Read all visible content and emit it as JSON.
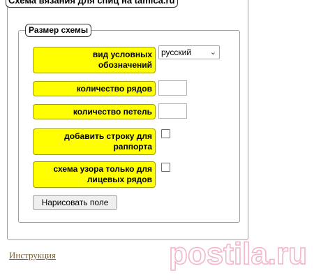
{
  "form": {
    "title": "Схема вязания для спиц на tamica.ru",
    "section_title": "Размер схемы",
    "symbols_type": {
      "label": "вид условных обозначений",
      "selected": "русский"
    },
    "rows": {
      "label": "количество рядов",
      "value": ""
    },
    "stitches": {
      "label": "количество петель",
      "value": ""
    },
    "add_repeat_row": {
      "label": "добавить строку для раппорта",
      "checked": false
    },
    "front_rows_only": {
      "label": "схема узора только для лицевых рядов",
      "checked": false
    },
    "draw_button": "Нарисовать поле"
  },
  "footer": {
    "instructions_link": "Инструкция"
  },
  "watermark": {
    "text": "postila.ru",
    "color": "#f3b6c8"
  }
}
